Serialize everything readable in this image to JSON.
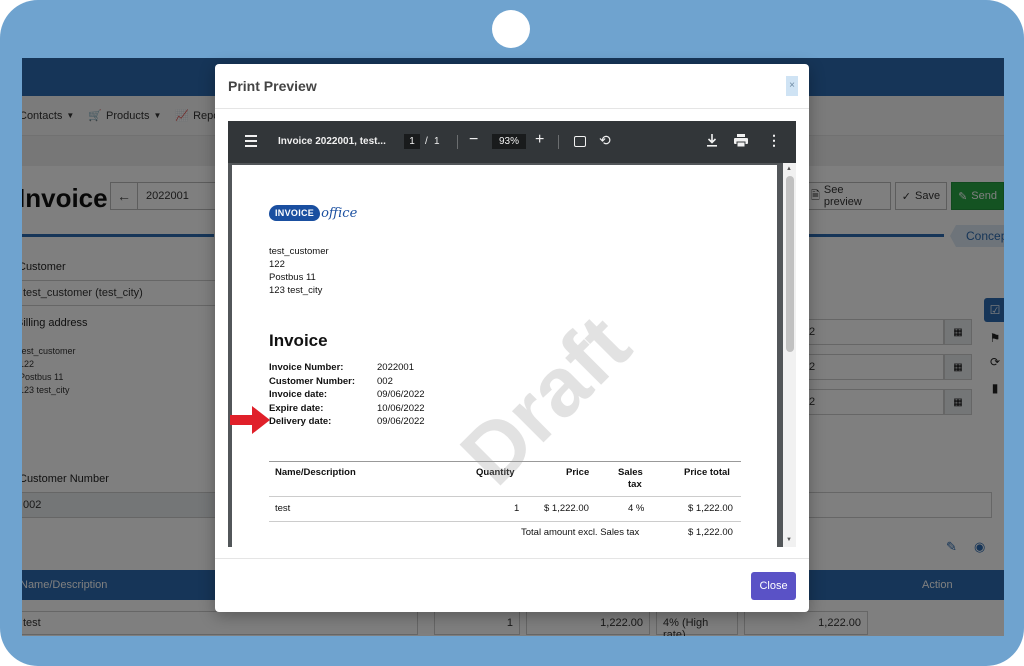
{
  "app": {
    "nav": {
      "contacts": "Contacts",
      "products": "Products",
      "reports": "Repo"
    },
    "page_title": "Invoice",
    "invoice_number_field": "2022001",
    "buttons": {
      "see_preview": "See preview",
      "save": "Save",
      "send": "Send"
    },
    "concept_tab": "Concep",
    "labels": {
      "customer": "Customer",
      "billing_address": "Billing address",
      "customer_number": "Customer Number"
    },
    "customer_field": "test_customer (test_city)",
    "billing_address_lines": [
      "test_customer",
      "122",
      "Postbus 11",
      "123 test_city"
    ],
    "customer_number_field": "002",
    "date_fields": [
      "2",
      "2",
      "2"
    ],
    "table": {
      "col_name": "Name/Description",
      "col_action": "Action",
      "row": {
        "name": "test",
        "quantity": "1",
        "price": "1,222.00",
        "tax": "4% (High rate)",
        "total": "1,222.00"
      }
    }
  },
  "modal": {
    "title": "Print Preview",
    "close_x": "×",
    "close_button": "Close"
  },
  "pdf_viewer": {
    "doc_title": "Invoice 2022001, test...",
    "current_page": "1",
    "total_pages": "1",
    "page_sep": "/",
    "zoom": "93%",
    "zoom_out": "−",
    "zoom_in": "+",
    "more": "⋮"
  },
  "pdf_page": {
    "logo_word_1": "INVOICE",
    "logo_word_2": "office",
    "customer_lines": [
      "test_customer",
      "122",
      "Postbus 11",
      "123 test_city"
    ],
    "heading": "Invoice",
    "meta": [
      {
        "k": "Invoice Number:",
        "v": "2022001"
      },
      {
        "k": "Customer Number:",
        "v": "002"
      },
      {
        "k": "Invoice date:",
        "v": "09/06/2022"
      },
      {
        "k": "Expire date:",
        "v": "10/06/2022"
      },
      {
        "k": "Delivery date:",
        "v": "09/06/2022"
      }
    ],
    "table_headers": {
      "name": "Name/Description",
      "quantity": "Quantity",
      "price": "Price",
      "tax_1": "Sales",
      "tax_2": "tax",
      "total": "Price total"
    },
    "row": {
      "name": "test",
      "quantity": "1",
      "price": "$ 1,222.00",
      "tax": "4 %",
      "total": "$ 1,222.00"
    },
    "subtotal_label": "Total amount excl. Sales tax",
    "subtotal_value": "$ 1,222.00",
    "watermark": "Draft"
  },
  "colors": {
    "frame": "#6fa3cf",
    "brand_blue": "#2d6bb0",
    "send_green": "#28a745",
    "close_button": "#5a52c6",
    "arrow_red": "#e0202a"
  },
  "icons": {
    "nav_contacts": "chevron-down-icon",
    "nav_products": "cart-icon",
    "nav_reports": "chart-icon",
    "back": "arrow-left-icon",
    "preview": "file-icon",
    "save": "check-circle-icon",
    "send": "edit-icon",
    "calendar": "calendar-icon",
    "viewer_menu": "hamburger-icon",
    "download": "download-icon",
    "print": "print-icon",
    "rotate": "rotate-icon",
    "fit": "fit-page-icon"
  }
}
